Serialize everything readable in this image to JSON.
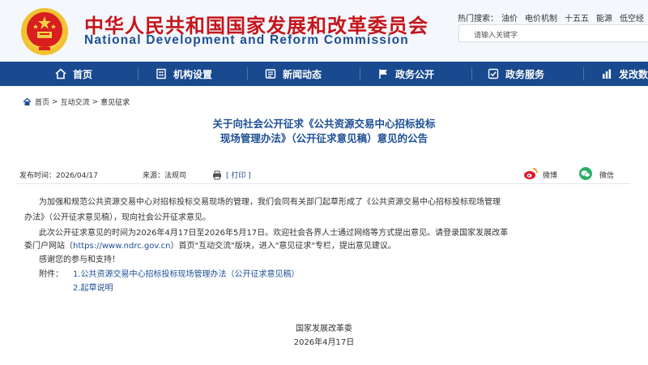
{
  "header": {
    "title_cn": "中华人民共和国国家发展和改革委员会",
    "title_en": "National Development and Reform Commission",
    "hot_label": "热门搜索：",
    "hot_terms": [
      "油价",
      "电价机制",
      "十五五",
      "能源",
      "低空经"
    ],
    "search_placeholder": "请输入关键字"
  },
  "nav": {
    "items": [
      {
        "label": "首页",
        "icon": "home-icon"
      },
      {
        "label": "机构设置",
        "icon": "building-icon"
      },
      {
        "label": "新闻动态",
        "icon": "news-icon"
      },
      {
        "label": "政务公开",
        "icon": "flag-icon"
      },
      {
        "label": "政务服务",
        "icon": "service-icon"
      },
      {
        "label": "发改数",
        "icon": "data-icon"
      }
    ]
  },
  "breadcrumb": {
    "items": [
      "首页",
      "互动交流",
      "意见征求"
    ],
    "sep": ">"
  },
  "article": {
    "title_line1": "关于向社会公开征求《公共资源交易中心招标投标",
    "title_line2": "现场管理办法》（公开征求意见稿）意见的公告",
    "date": "发布时间：2026/04/17",
    "source": "来源：法规司",
    "print_label": "[ 打印 ]",
    "share_weibo": "微博",
    "share_wechat": "微信",
    "p1_line1": "为加强和规范公共资源交易中心对招标投标交易现场的管理，我们会同有关部门起草形成了《公共资源交易中心招标投标现场管理",
    "p1_line2": "办法》（公开征求意见稿），现向社会公开征求意见。",
    "p2_line1": "此次公开征求意见的时间为2026年4月17日至2026年5月17日。欢迎社会各界人士通过网络等方式提出意见。请登录国家发展改革",
    "p2_line2_a": "委门户网站（",
    "p2_line2_link": "https://www.ndrc.gov.cn",
    "p2_line2_b": "）首页\"互动交流\"版块，进入\"意见征求\"专栏，提出意见建议。",
    "thanks": "感谢您的参与和支持！",
    "attach_label": "附件：",
    "attachments": [
      "1.公共资源交易中心招标投标现场管理办法（公开征求意见稿）",
      "2.起草说明"
    ],
    "sign_org": "国家发展改革委",
    "sign_date": "2026年4月17日"
  },
  "colors": {
    "nav_bg": "#19498f",
    "title_red": "#c4161c",
    "brand_blue": "#1d4f95",
    "weibo_red": "#e6162d",
    "wechat_green": "#2aae67"
  }
}
